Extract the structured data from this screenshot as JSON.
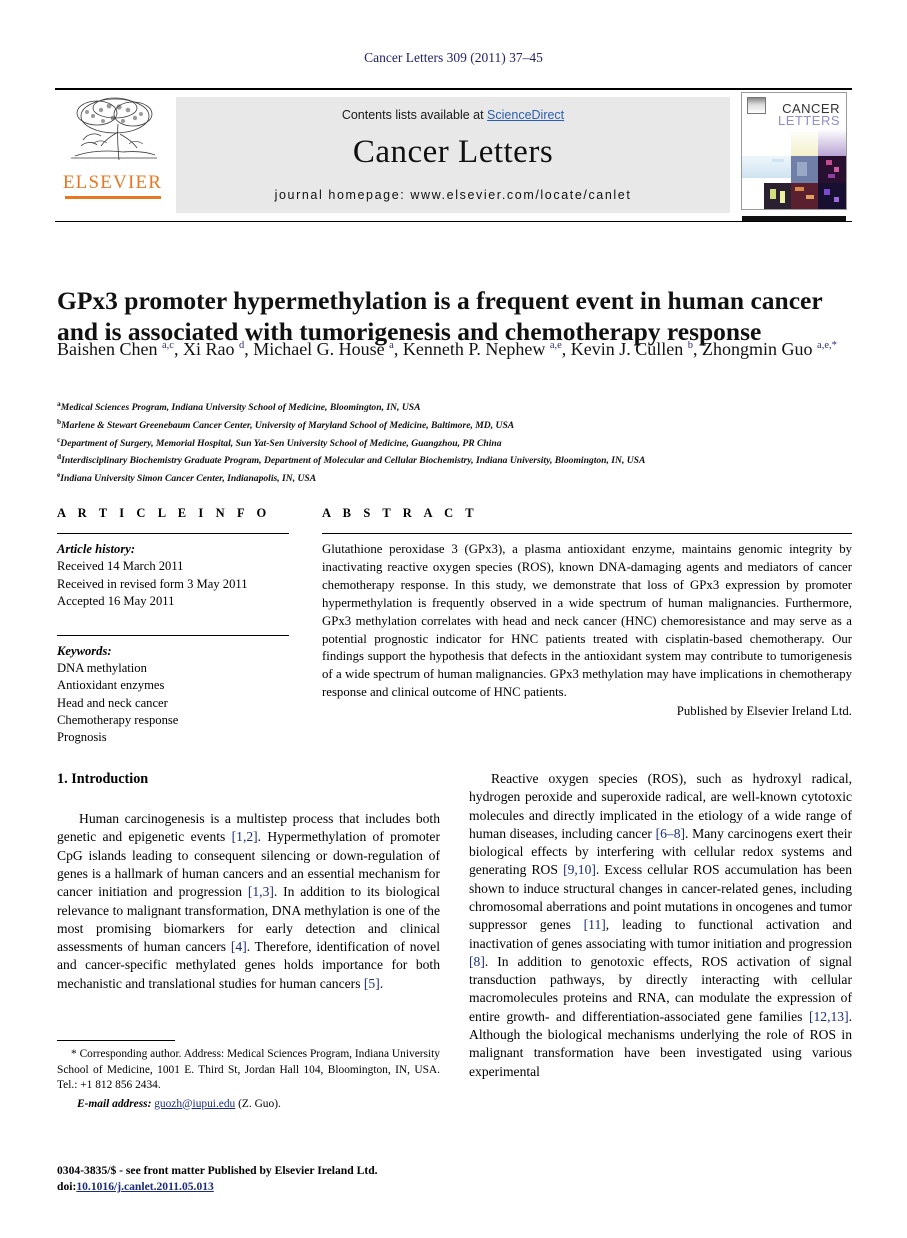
{
  "running_head": "Cancer Letters 309 (2011) 37–45",
  "masthead": {
    "contents_prefix": "Contents lists available at ",
    "sciencedirect": "ScienceDirect",
    "journal_title": "Cancer Letters",
    "homepage": "journal homepage: www.elsevier.com/locate/canlet",
    "publisher_logo_text": "ELSEVIER",
    "cover_title_line1": "CANCER",
    "cover_title_line2": "LETTERS",
    "accent_orange": "#E87722",
    "link_blue": "#2b5fb3"
  },
  "article": {
    "title": "GPx3 promoter hypermethylation is a frequent event in human cancer and is associated with tumorigenesis and chemotherapy response",
    "authors_html": "Baishen Chen <sup>a,c</sup>, Xi Rao <sup>d</sup>, Michael G. House <sup>a</sup>, Kenneth P. Nephew <sup>a,e</sup>, Kevin J. Cullen <sup>b</sup>, Zhongmin Guo <sup>a,e,*</sup>",
    "affiliations": [
      {
        "mark": "a",
        "text": "Medical Sciences Program, Indiana University School of Medicine, Bloomington, IN, USA"
      },
      {
        "mark": "b",
        "text": "Marlene & Stewart Greenebaum Cancer Center, University of Maryland School of Medicine, Baltimore, MD, USA"
      },
      {
        "mark": "c",
        "text": "Department of Surgery, Memorial Hospital, Sun Yat-Sen University School of Medicine, Guangzhou, PR China"
      },
      {
        "mark": "d",
        "text": "Interdisciplinary Biochemistry Graduate Program, Department of Molecular and Cellular Biochemistry, Indiana University, Bloomington, IN, USA"
      },
      {
        "mark": "e",
        "text": "Indiana University Simon Cancer Center, Indianapolis, IN, USA"
      }
    ]
  },
  "article_info": {
    "heading": "A R T I C L E   I N F O",
    "history_label": "Article history:",
    "history": [
      "Received 14 March 2011",
      "Received in revised form 3 May 2011",
      "Accepted 16 May 2011"
    ],
    "keywords_label": "Keywords:",
    "keywords": [
      "DNA methylation",
      "Antioxidant enzymes",
      "Head and neck cancer",
      "Chemotherapy response",
      "Prognosis"
    ]
  },
  "abstract": {
    "heading": "A B S T R A C T",
    "text": "Glutathione peroxidase 3 (GPx3), a plasma antioxidant enzyme, maintains genomic integrity by inactivating reactive oxygen species (ROS), known DNA-damaging agents and mediators of cancer chemotherapy response. In this study, we demonstrate that loss of GPx3 expression by promoter hypermethylation is frequently observed in a wide spectrum of human malignancies. Furthermore, GPx3 methylation correlates with head and neck cancer (HNC) chemoresistance and may serve as a potential prognostic indicator for HNC patients treated with cisplatin-based chemotherapy. Our findings support the hypothesis that defects in the antioxidant system may contribute to tumorigenesis of a wide spectrum of human malignancies. GPx3 methylation may have implications in chemotherapy response and clinical outcome of HNC patients.",
    "publisher_line": "Published by Elsevier Ireland Ltd."
  },
  "body": {
    "section1_heading": "1. Introduction",
    "left_paragraph_parts": [
      "Human carcinogenesis is a multistep process that includes both genetic and epigenetic events ",
      "[1,2]",
      ". Hypermethylation of promoter CpG islands leading to consequent silencing or down-regulation of genes is a hallmark of human cancers and an essential mechanism for cancer initiation and progression ",
      "[1,3]",
      ". In addition to its biological relevance to malignant transformation, DNA methylation is one of the most promising biomarkers for early detection and clinical assessments of human cancers ",
      "[4]",
      ". Therefore, identification of novel and cancer-specific methylated genes holds importance for both mechanistic and translational studies for human cancers ",
      "[5]",
      "."
    ],
    "right_paragraph_parts": [
      "Reactive oxygen species (ROS), such as hydroxyl radical, hydrogen peroxide and superoxide radical, are well-known cytotoxic molecules and directly implicated in the etiology of a wide range of human diseases, including cancer ",
      "[6–8]",
      ". Many carcinogens exert their biological effects by interfering with cellular redox systems and generating ROS ",
      "[9,10]",
      ". Excess cellular ROS accumulation has been shown to induce structural changes in cancer-related genes, including chromosomal aberrations and point mutations in oncogenes and tumor suppressor genes ",
      "[11]",
      ", leading to functional activation and inactivation of genes associating with tumor initiation and progression ",
      "[8]",
      ". In addition to genotoxic effects, ROS activation of signal transduction pathways, by directly interacting with cellular macromolecules proteins and RNA, can modulate the expression of entire growth- and differentiation-associated gene families ",
      "[12,13]",
      ". Although the biological mechanisms underlying the role of ROS in malignant transformation have been investigated using various experimental"
    ]
  },
  "footnotes": {
    "corresponding_mark": "*",
    "corresponding_text": "Corresponding author. Address: Medical Sciences Program, Indiana University School of Medicine, 1001 E. Third St, Jordan Hall 104, Bloomington, IN, USA. Tel.: +1 812 856 2434.",
    "email_label": "E-mail address:",
    "email": "guozh@iupui.edu",
    "email_suffix": "(Z. Guo).",
    "issn_line": "0304-3835/$ - see front matter Published by Elsevier Ireland Ltd.",
    "doi_label": "doi:",
    "doi": "10.1016/j.canlet.2011.05.013"
  }
}
